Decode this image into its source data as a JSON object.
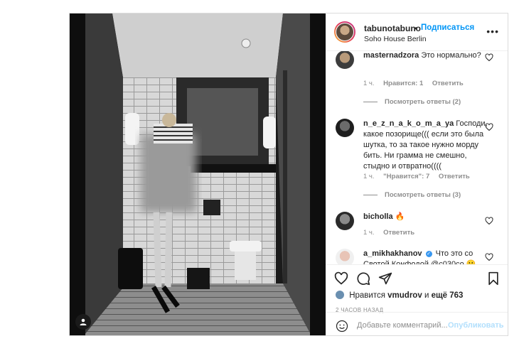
{
  "post": {
    "username": "tabunotabuno",
    "dot": "•",
    "follow_label": "Подписаться",
    "location": "Soho House Berlin",
    "more_label": "•••"
  },
  "comments": [
    {
      "username": "masternadzora",
      "text": "Это нормально?",
      "time": "1 ч.",
      "likes": "Нравится: 1",
      "reply": "Ответить",
      "view_replies": "Посмотреть ответы (2)"
    },
    {
      "username": "n_e_z_n_a_k_o_m_a_ya",
      "text": "Господи, какое позорище((( если это была шутка, то за такое нужно морду бить. Ни грамма не смешно, стыдно и отвратно((((",
      "time": "1 ч.",
      "likes": "\"Нравится\": 7",
      "reply": "Ответить",
      "view_replies": "Посмотреть ответы (3)"
    },
    {
      "username": "bicholla",
      "text": "🔥",
      "time": "1 ч.",
      "reply": "Ответить"
    },
    {
      "username": "a_mikhakhanov",
      "text": "Что это со Свотой Конфодой @с030со 😬"
    }
  ],
  "likes_line": {
    "prefix": "Нравится",
    "user": "vmudrov",
    "and": "и",
    "more": "ещё 763"
  },
  "timestamp": "2 ЧАСОВ НАЗАД",
  "add_comment": {
    "placeholder": "Добавьте комментарий...",
    "publish_label": "Опубликовать"
  },
  "colors": {
    "accent": "#0095f6",
    "muted": "#8e8e8e",
    "border": "#dbdbdb",
    "publish_disabled": "#b2dffc"
  }
}
